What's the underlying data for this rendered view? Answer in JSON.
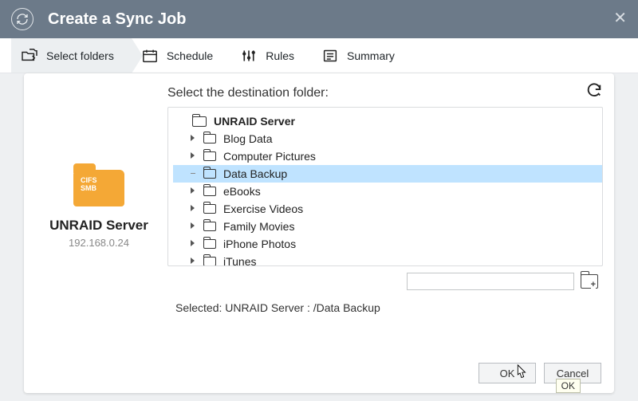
{
  "title": "Create a Sync Job",
  "steps": [
    {
      "label": "Select folders",
      "active": true
    },
    {
      "label": "Schedule",
      "active": false
    },
    {
      "label": "Rules",
      "active": false
    },
    {
      "label": "Summary",
      "active": false
    }
  ],
  "source": {
    "badge": "CIFS\nSMB",
    "name": "UNRAID Server",
    "ip": "192.168.0.24"
  },
  "destination": {
    "heading": "Select the destination folder:",
    "root": "UNRAID Server",
    "items": [
      {
        "name": "Blog Data",
        "expandable": true,
        "selected": false
      },
      {
        "name": "Computer Pictures",
        "expandable": true,
        "selected": false
      },
      {
        "name": "Data Backup",
        "expandable": false,
        "selected": true
      },
      {
        "name": "eBooks",
        "expandable": true,
        "selected": false
      },
      {
        "name": "Exercise Videos",
        "expandable": true,
        "selected": false
      },
      {
        "name": "Family Movies",
        "expandable": true,
        "selected": false
      },
      {
        "name": "iPhone Photos",
        "expandable": true,
        "selected": false
      },
      {
        "name": "iTunes",
        "expandable": true,
        "selected": false
      }
    ],
    "selected_label": "Selected:",
    "selected_path": "UNRAID Server : /Data Backup"
  },
  "buttons": {
    "ok": "OK",
    "cancel": "Cancel"
  },
  "tooltip": "OK"
}
